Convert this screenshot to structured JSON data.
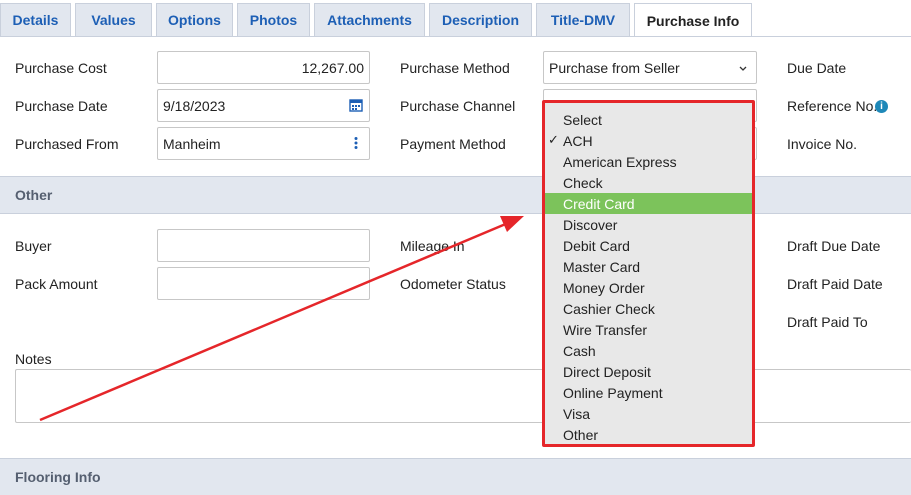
{
  "tabs": [
    "Details",
    "Values",
    "Options",
    "Photos",
    "Attachments",
    "Description",
    "Title-DMV",
    "Purchase Info"
  ],
  "active_tab": "Purchase Info",
  "purchase": {
    "cost_label": "Purchase Cost",
    "cost_value": "12,267.00",
    "date_label": "Purchase Date",
    "date_value": "9/18/2023",
    "from_label": "Purchased From",
    "from_value": "Manheim",
    "method_label": "Purchase Method",
    "method_value": "Purchase from Seller",
    "channel_label": "Purchase Channel",
    "payment_label": "Payment Method",
    "due_date_label": "Due Date",
    "reference_label": "Reference No.",
    "invoice_label": "Invoice No."
  },
  "other": {
    "section_title": "Other",
    "buyer_label": "Buyer",
    "buyer_value": "",
    "pack_label": "Pack Amount",
    "pack_value": "",
    "mileage_label": "Mileage In",
    "odometer_label": "Odometer Status",
    "draft_due_label": "Draft Due Date",
    "draft_paid_date_label": "Draft Paid Date",
    "draft_paid_to_label": "Draft Paid To",
    "notes_label": "Notes",
    "notes_value": ""
  },
  "flooring": {
    "section_title": "Flooring Info"
  },
  "payment_dropdown": {
    "options": [
      "Select",
      "ACH",
      "American Express",
      "Check",
      "Credit Card",
      "Discover",
      "Debit Card",
      "Master Card",
      "Money Order",
      "Cashier Check",
      "Wire Transfer",
      "Cash",
      "Direct Deposit",
      "Online Payment",
      "Visa",
      "Other"
    ],
    "checked": "ACH",
    "highlighted": "Credit Card"
  },
  "colors": {
    "highlight": "#7cc35b",
    "annotation": "#e5262a",
    "tab_text": "#1d5fb5",
    "section_bg": "#e2e7ef"
  }
}
